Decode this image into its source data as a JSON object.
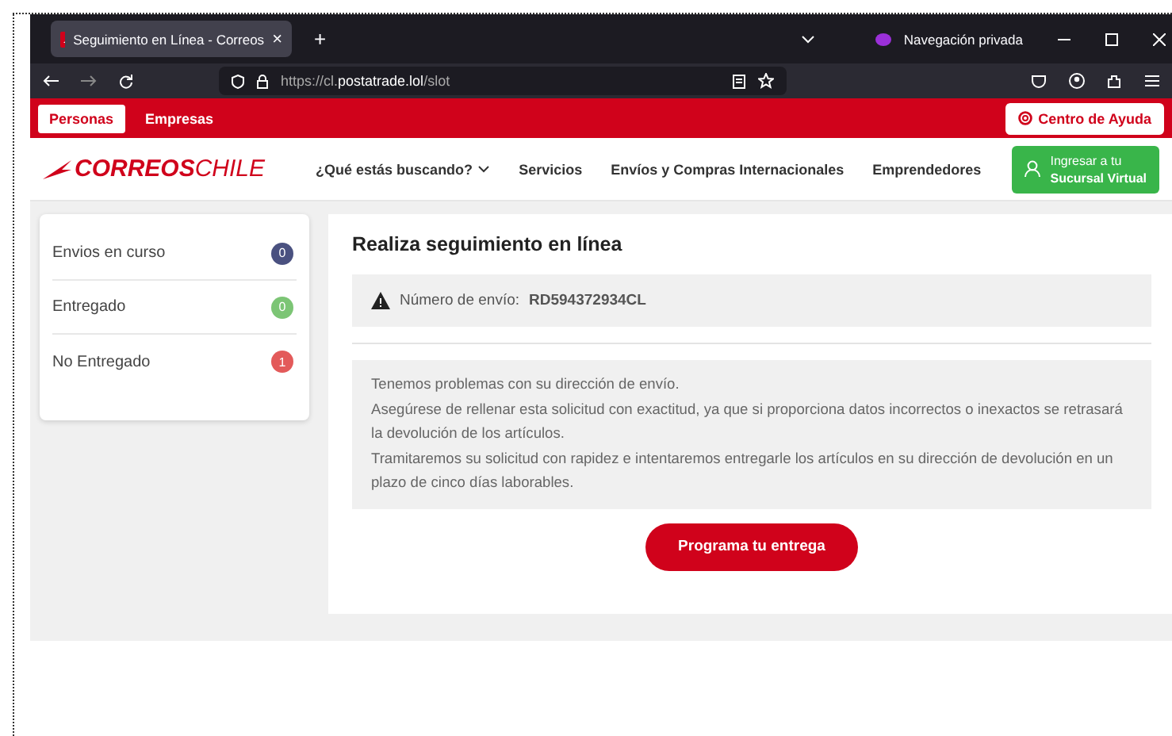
{
  "browser": {
    "tab_title": "Seguimiento en Línea - Correos",
    "close_glyph": "×",
    "new_tab_glyph": "+",
    "private_label": "Navegación privada",
    "url_prefix": "https://cl.",
    "url_domain": "postatrade.lol",
    "url_path": "/slot"
  },
  "top_bar": {
    "segments": [
      {
        "label": "Personas",
        "selected": true
      },
      {
        "label": "Empresas",
        "selected": false
      }
    ],
    "help": "Centro de Ayuda"
  },
  "nav": {
    "logo_left": "CORREOS",
    "logo_right": "CHILE",
    "items": [
      {
        "label": "¿Qué estás buscando?",
        "kind": "dropdown"
      },
      {
        "label": "Servicios",
        "kind": "link"
      },
      {
        "label": "Envíos y Compras Internacionales",
        "kind": "link"
      },
      {
        "label": "Emprendedores",
        "kind": "link"
      }
    ],
    "login_line1": "Ingresar a tu",
    "login_line2": "Sucursal Virtual"
  },
  "sidebar": {
    "items": [
      {
        "label": "Envios en curso",
        "count": "0",
        "color": "#4a5180"
      },
      {
        "label": "Entregado",
        "count": "0",
        "color": "#7cc575"
      },
      {
        "label": "No Entregado",
        "count": "1",
        "color": "#e35a5a"
      }
    ]
  },
  "main": {
    "title": "Realiza seguimiento en línea",
    "tracking_label": "Número de envío:",
    "tracking_number": "RD594372934CL",
    "message": [
      "Tenemos problemas con su dirección de envío.",
      "Asegúrese de rellenar esta solicitud con exactitud, ya que si proporciona datos incorrectos o inexactos se retrasará la devolución de los artículos.",
      "Tramitaremos su solicitud con rapidez e intentaremos entregarle los artículos en su dirección de devolución en un plazo de cinco días laborables."
    ],
    "button": "Programa tu entrega"
  }
}
